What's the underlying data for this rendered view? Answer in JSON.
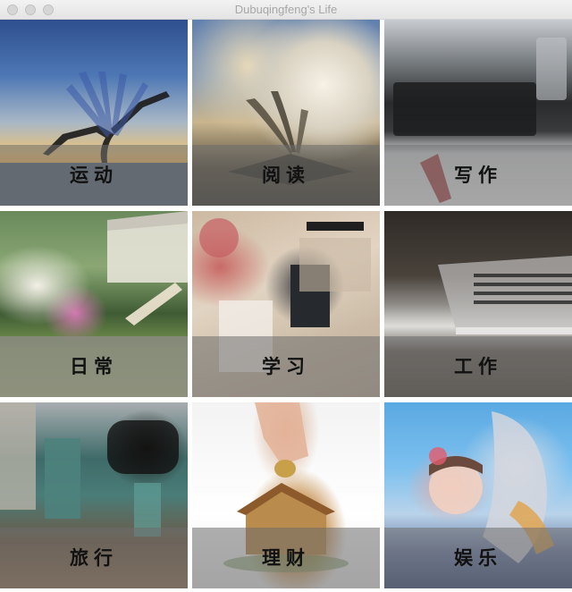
{
  "window": {
    "title": "Dubuqingfeng's Life"
  },
  "tiles": [
    {
      "label": "运动"
    },
    {
      "label": "阅读"
    },
    {
      "label": "写作"
    },
    {
      "label": "日常"
    },
    {
      "label": "学习"
    },
    {
      "label": "工作"
    },
    {
      "label": "旅行"
    },
    {
      "label": "理财"
    },
    {
      "label": "娱乐"
    }
  ]
}
